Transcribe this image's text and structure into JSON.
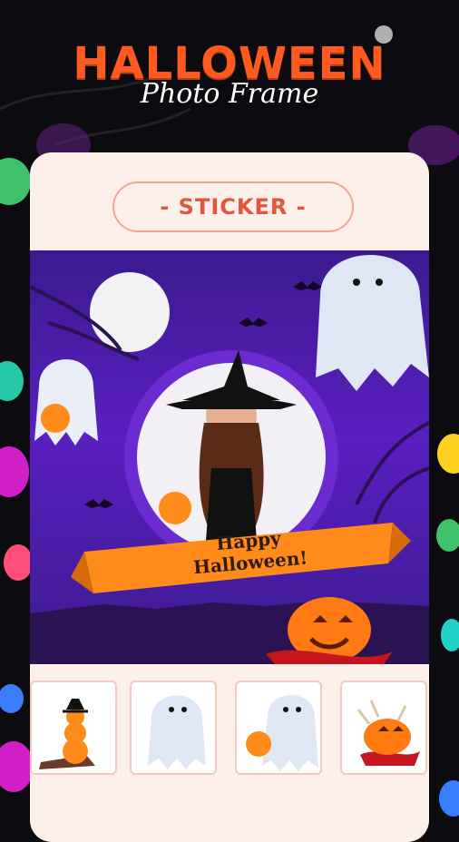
{
  "header": {
    "title": "HALLOWEEN",
    "subtitle": "Photo Frame"
  },
  "editor": {
    "section_label": "- STICKER -",
    "preview_banner": "Happy Halloween!"
  },
  "stickers": [
    {
      "icon": "stacked-pumpkins-icon"
    },
    {
      "icon": "ghost-icon"
    },
    {
      "icon": "ghost-with-pumpkin-icon"
    },
    {
      "icon": "skeleton-pumpkin-icon"
    }
  ],
  "colors": {
    "title": "#ff5a1f",
    "accent": "#e2563b",
    "card": "#fdf0ea",
    "preview_purple": "#5a1fc0",
    "banner_orange": "#ff8c1a"
  }
}
